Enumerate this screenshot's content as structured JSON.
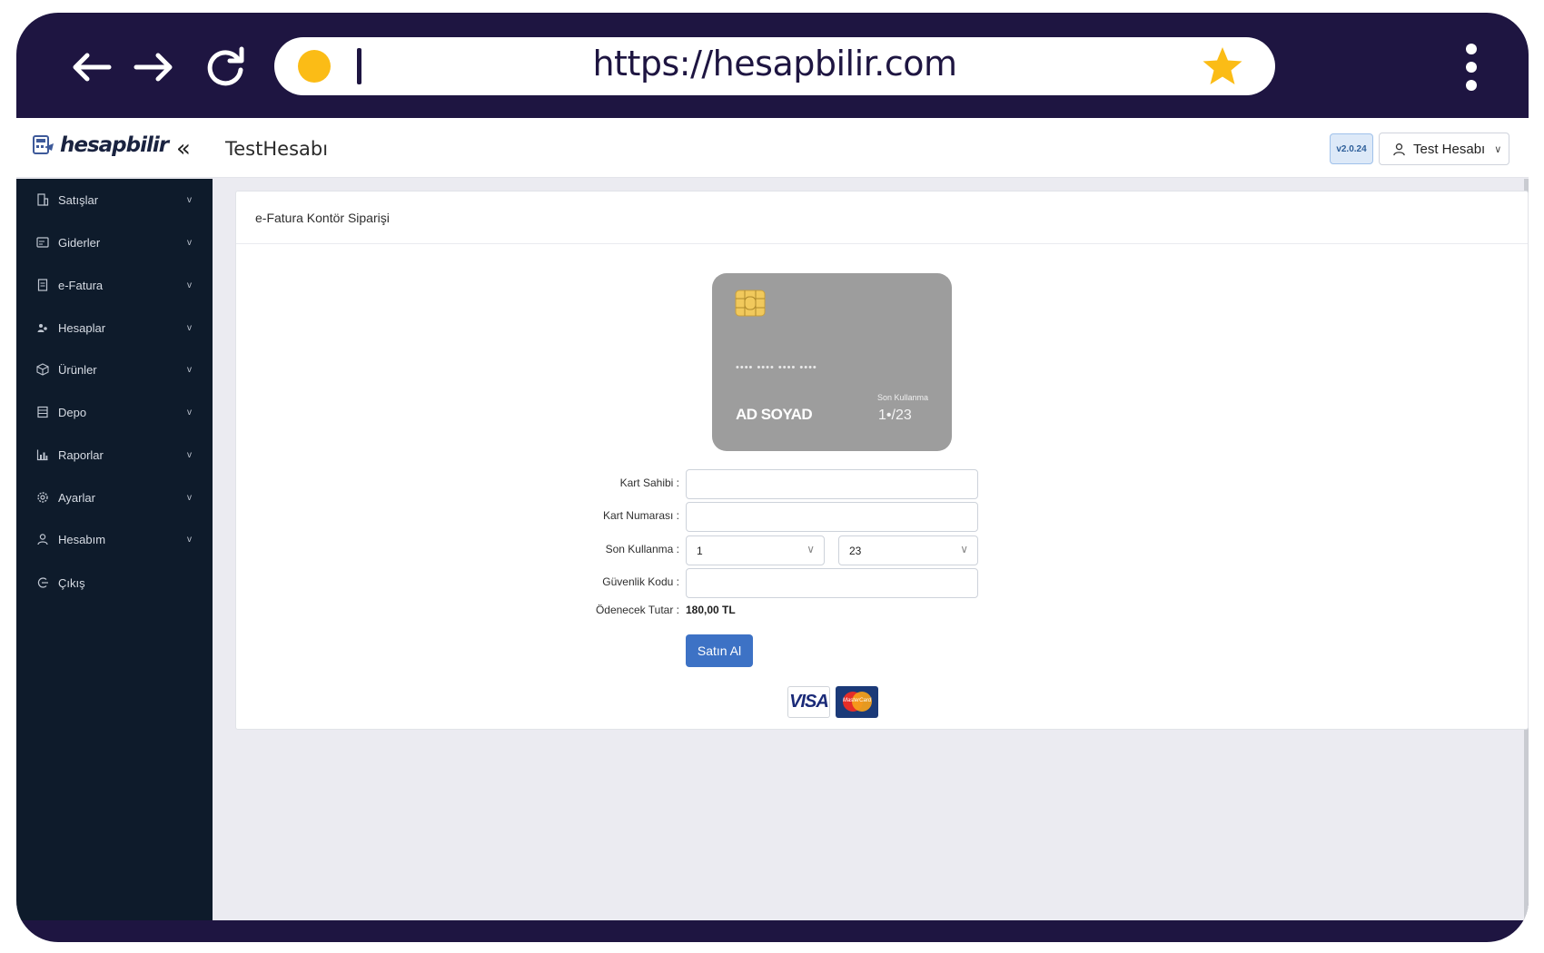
{
  "browser": {
    "url": "https://hesapbilir.com",
    "icons": [
      "back-arrow-icon",
      "forward-arrow-icon",
      "reload-icon",
      "bookmark-star-icon",
      "kebab-menu-icon"
    ],
    "colors": {
      "frame": "#1e1541",
      "dot": "#fbbc16",
      "star": "#fbbc16"
    }
  },
  "topbar": {
    "logo_text": "hesapbilir",
    "collapse": "«",
    "title": "TestHesabı",
    "version": "v2.0.24",
    "user": "Test Hesabı"
  },
  "sidebar": {
    "items": [
      {
        "label": "Satışlar",
        "icon": "building-icon",
        "has_submenu": true
      },
      {
        "label": "Giderler",
        "icon": "receipt-icon",
        "has_submenu": true
      },
      {
        "label": "e-Fatura",
        "icon": "invoice-icon",
        "has_submenu": true
      },
      {
        "label": "Hesaplar",
        "icon": "users-icon",
        "has_submenu": true
      },
      {
        "label": "Ürünler",
        "icon": "box-icon",
        "has_submenu": true
      },
      {
        "label": "Depo",
        "icon": "warehouse-icon",
        "has_submenu": true
      },
      {
        "label": "Raporlar",
        "icon": "chart-icon",
        "has_submenu": true
      },
      {
        "label": "Ayarlar",
        "icon": "gear-icon",
        "has_submenu": true
      },
      {
        "label": "Hesabım",
        "icon": "user-icon",
        "has_submenu": true
      },
      {
        "label": "Çıkış",
        "icon": "logout-icon",
        "has_submenu": false
      }
    ],
    "submenu_arrow": "v"
  },
  "main": {
    "card_title": "e-Fatura Kontör Siparişi",
    "credit_card": {
      "number": "•••• •••• •••• ••••",
      "name": "AD SOYAD",
      "expiry_label": "Son Kullanma",
      "expiry": "1•/23"
    },
    "form": {
      "holder_label": "Kart Sahibi :",
      "holder_value": "",
      "number_label": "Kart Numarası :",
      "number_value": "",
      "expiry_label": "Son Kullanma :",
      "expiry_month": "1",
      "expiry_year": "23",
      "cvc_label": "Güvenlik Kodu :",
      "cvc_value": "",
      "total_label": "Ödenecek Tutar :",
      "total_value": "180,00 TL",
      "submit": "Satın Al"
    },
    "payment_logos": {
      "visa": "VISA",
      "mastercard": "MasterCard"
    }
  }
}
